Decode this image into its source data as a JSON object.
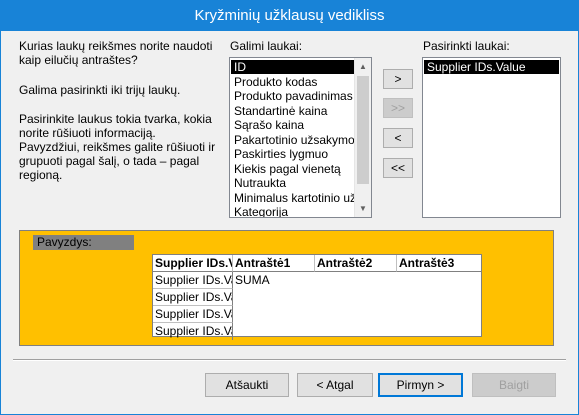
{
  "dialog": {
    "title": "Kryžminių užklausų vedikliss"
  },
  "instructions": {
    "question": "Kurias laukų reikšmes norite naudoti kaip eilučių antraštes?",
    "limit": "Galima pasirinkti iki trijų laukų.",
    "order_hint": "Pasirinkite laukus tokia tvarka, kokia norite rūšiuoti informaciją. Pavyzdžiui, reikšmes galite rūšiuoti ir grupuoti pagal šalį, o tada – pagal regioną."
  },
  "available_fields": {
    "label": "Galimi laukai:",
    "items": [
      "ID",
      "Produkto kodas",
      "Produkto pavadinimas",
      "Standartinė kaina",
      "Sąrašo kaina",
      "Pakartotinio užsakymo lyg",
      "Paskirties lygmuo",
      "Kiekis pagal vienetą",
      "Nutraukta",
      "Minimalus kartotinio užsaky",
      "Kategorija"
    ],
    "selected_index": 0
  },
  "selected_fields": {
    "label": "Pasirinkti laukai:",
    "items": [
      "Supplier IDs.Value"
    ]
  },
  "move_buttons": {
    "add_one": ">",
    "add_all": ">>",
    "remove_one": "<",
    "remove_all": "<<"
  },
  "preview": {
    "label": "Pavyzdys:",
    "corner_header": "Supplier IDs.V",
    "column_headers": [
      "Antraštė1",
      "Antraštė2",
      "Antraštė3"
    ],
    "row_headers": [
      "Supplier IDs.Value",
      "Supplier IDs.Value",
      "Supplier IDs.Value",
      "Supplier IDs.Value"
    ],
    "first_cell": "SUMA"
  },
  "footer": {
    "cancel": "Atšaukti",
    "back": "< Atgal",
    "next": "Pirmyn >",
    "finish": "Baigti"
  },
  "colors": {
    "title_bar": "#1883d7",
    "preview_background": "#ffc000",
    "selection": "#000000"
  }
}
